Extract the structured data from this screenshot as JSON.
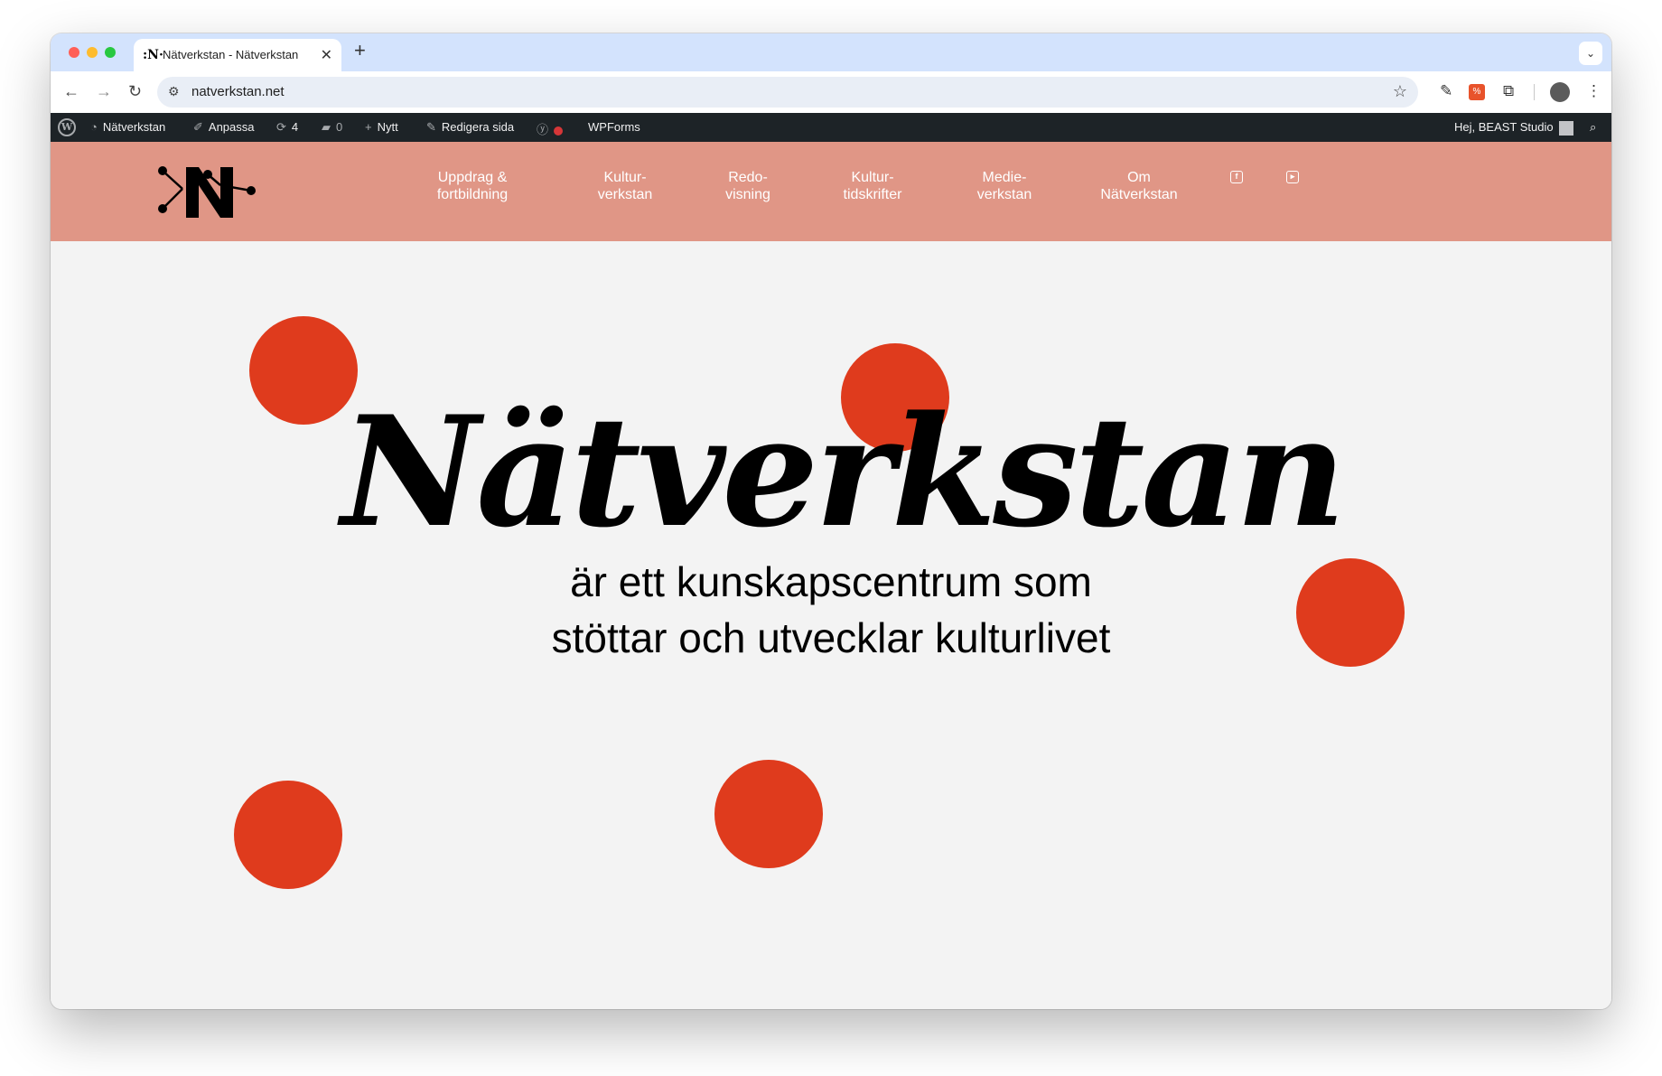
{
  "browser": {
    "tab_title": "Nätverkstan - Nätverkstan",
    "tab_favicon": ":N·",
    "url": "natverkstan.net"
  },
  "adminbar": {
    "site_name": "Nätverkstan",
    "customize": "Anpassa",
    "updates_count": "4",
    "comments_count": "0",
    "new_label": "Nytt",
    "edit_page": "Redigera sida",
    "wpforms": "WPForms",
    "greeting": "Hej, BEAST Studio"
  },
  "nav": {
    "items": [
      {
        "label": "Uppdrag &\nfortbildning"
      },
      {
        "label": "Kultur-\nverkstan"
      },
      {
        "label": "Redo-\nvisning"
      },
      {
        "label": "Kultur-\ntidskrifter"
      },
      {
        "label": "Medie-\nverkstan"
      },
      {
        "label": "Om\nNätverkstan"
      }
    ],
    "social": [
      "facebook-icon",
      "youtube-icon"
    ]
  },
  "hero": {
    "title": "Nätverkstan",
    "subtitle_line1": "är ett kunskapscentrum som",
    "subtitle_line2": "stöttar och utvecklar kulturlivet"
  },
  "colors": {
    "header_bg": "#e09686",
    "accent_dot": "#df3b1d",
    "page_bg": "#f3f3f3",
    "adminbar_bg": "#1d2327"
  }
}
